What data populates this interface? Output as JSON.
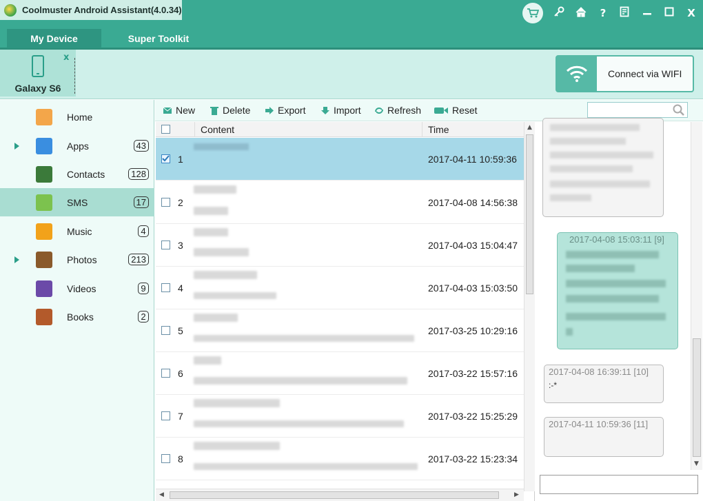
{
  "app": {
    "title": "Coolmuster Android Assistant(4.0.34)"
  },
  "title_controls": [
    "cart-icon",
    "key-icon",
    "home-icon",
    "help-icon",
    "feedback-icon",
    "minimize-icon",
    "maximize-icon",
    "close-icon"
  ],
  "title_glyphs": {
    "help": "?",
    "close": "X"
  },
  "tabs": [
    {
      "label": "My Device",
      "active": true
    },
    {
      "label": "Super Toolkit",
      "active": false
    }
  ],
  "device": {
    "name": "Galaxy S6",
    "close": "x"
  },
  "wifi": {
    "label": "Connect via WIFI"
  },
  "sidebar": {
    "items": [
      {
        "label": "Home",
        "count": "",
        "expandable": false,
        "icon": "home-icon"
      },
      {
        "label": "Apps",
        "count": "43",
        "expandable": true,
        "icon": "apps-icon"
      },
      {
        "label": "Contacts",
        "count": "128",
        "expandable": false,
        "icon": "contacts-icon"
      },
      {
        "label": "SMS",
        "count": "17",
        "expandable": false,
        "icon": "sms-icon",
        "active": true
      },
      {
        "label": "Music",
        "count": "4",
        "expandable": false,
        "icon": "music-icon"
      },
      {
        "label": "Photos",
        "count": "213",
        "expandable": true,
        "icon": "photos-icon"
      },
      {
        "label": "Videos",
        "count": "9",
        "expandable": false,
        "icon": "videos-icon"
      },
      {
        "label": "Books",
        "count": "2",
        "expandable": false,
        "icon": "books-icon"
      }
    ]
  },
  "toolbar": {
    "new": "New",
    "delete": "Delete",
    "export": "Export",
    "import": "Import",
    "refresh": "Refresh",
    "reset": "Reset"
  },
  "search": {
    "placeholder": ""
  },
  "table": {
    "columns": {
      "content": "Content",
      "time": "Time"
    },
    "rows": [
      {
        "num": "1",
        "time": "2017-04-11 10:59:36",
        "checked": true
      },
      {
        "num": "2",
        "time": "2017-04-08 14:56:38",
        "checked": false
      },
      {
        "num": "3",
        "time": "2017-04-03 15:04:47",
        "checked": false
      },
      {
        "num": "4",
        "time": "2017-04-03 15:03:50",
        "checked": false
      },
      {
        "num": "5",
        "time": "2017-03-25 10:29:16",
        "checked": false
      },
      {
        "num": "6",
        "time": "2017-03-22 15:57:16",
        "checked": false
      },
      {
        "num": "7",
        "time": "2017-03-22 15:25:29",
        "checked": false
      },
      {
        "num": "8",
        "time": "2017-03-22 15:23:34",
        "checked": false
      }
    ]
  },
  "conversation": {
    "messages": [
      {
        "meta": "",
        "body": "",
        "direction": "in"
      },
      {
        "meta": "2017-04-08 15:03:11  [9]",
        "body": "",
        "direction": "out"
      },
      {
        "meta": "2017-04-08 16:39:11  [10]",
        "body": ":-*",
        "direction": "in"
      },
      {
        "meta": "2017-04-11 10:59:36  [11]",
        "body": "",
        "direction": "in"
      }
    ]
  },
  "colors": {
    "brand": "#3aaa93",
    "selected_row": "#a6d8e8",
    "outgoing_bubble": "#b5e4da"
  }
}
